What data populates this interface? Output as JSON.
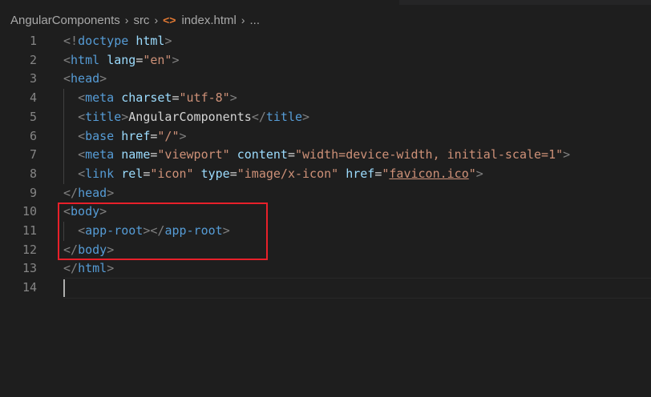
{
  "breadcrumb": {
    "project": "AngularComponents",
    "folder": "src",
    "file": "index.html",
    "more": "...",
    "file_icon_glyph": "<>"
  },
  "editor": {
    "lines": [
      {
        "number": "1",
        "tokens": [
          [
            "p",
            "<!"
          ],
          [
            "k",
            "doctype"
          ],
          [
            "x",
            " "
          ],
          [
            "a",
            "html"
          ],
          [
            "p",
            ">"
          ]
        ]
      },
      {
        "number": "2",
        "tokens": [
          [
            "p",
            "<"
          ],
          [
            "k",
            "html"
          ],
          [
            "x",
            " "
          ],
          [
            "a",
            "lang"
          ],
          [
            "x",
            "="
          ],
          [
            "s",
            "\"en\""
          ],
          [
            "p",
            ">"
          ]
        ]
      },
      {
        "number": "3",
        "tokens": [
          [
            "p",
            "<"
          ],
          [
            "k",
            "head"
          ],
          [
            "p",
            ">"
          ]
        ]
      },
      {
        "number": "4",
        "tokens": [
          [
            "x",
            "  "
          ],
          [
            "p",
            "<"
          ],
          [
            "k",
            "meta"
          ],
          [
            "x",
            " "
          ],
          [
            "a",
            "charset"
          ],
          [
            "x",
            "="
          ],
          [
            "s",
            "\"utf-8\""
          ],
          [
            "p",
            ">"
          ]
        ]
      },
      {
        "number": "5",
        "tokens": [
          [
            "x",
            "  "
          ],
          [
            "p",
            "<"
          ],
          [
            "k",
            "title"
          ],
          [
            "p",
            ">"
          ],
          [
            "x",
            "AngularComponents"
          ],
          [
            "p",
            "</"
          ],
          [
            "k",
            "title"
          ],
          [
            "p",
            ">"
          ]
        ]
      },
      {
        "number": "6",
        "tokens": [
          [
            "x",
            "  "
          ],
          [
            "p",
            "<"
          ],
          [
            "k",
            "base"
          ],
          [
            "x",
            " "
          ],
          [
            "a",
            "href"
          ],
          [
            "x",
            "="
          ],
          [
            "s",
            "\"/\""
          ],
          [
            "p",
            ">"
          ]
        ]
      },
      {
        "number": "7",
        "tokens": [
          [
            "x",
            "  "
          ],
          [
            "p",
            "<"
          ],
          [
            "k",
            "meta"
          ],
          [
            "x",
            " "
          ],
          [
            "a",
            "name"
          ],
          [
            "x",
            "="
          ],
          [
            "s",
            "\"viewport\""
          ],
          [
            "x",
            " "
          ],
          [
            "a",
            "content"
          ],
          [
            "x",
            "="
          ],
          [
            "s",
            "\"width=device-width, initial-scale=1\""
          ],
          [
            "p",
            ">"
          ]
        ]
      },
      {
        "number": "8",
        "tokens": [
          [
            "x",
            "  "
          ],
          [
            "p",
            "<"
          ],
          [
            "k",
            "link"
          ],
          [
            "x",
            " "
          ],
          [
            "a",
            "rel"
          ],
          [
            "x",
            "="
          ],
          [
            "s",
            "\"icon\""
          ],
          [
            "x",
            " "
          ],
          [
            "a",
            "type"
          ],
          [
            "x",
            "="
          ],
          [
            "s",
            "\"image/x-icon\""
          ],
          [
            "x",
            " "
          ],
          [
            "a",
            "href"
          ],
          [
            "x",
            "="
          ],
          [
            "s",
            "\""
          ],
          [
            "u",
            "favicon.ico"
          ],
          [
            "s",
            "\""
          ],
          [
            "p",
            ">"
          ]
        ]
      },
      {
        "number": "9",
        "tokens": [
          [
            "p",
            "</"
          ],
          [
            "k",
            "head"
          ],
          [
            "p",
            ">"
          ]
        ]
      },
      {
        "number": "10",
        "tokens": [
          [
            "p",
            "<"
          ],
          [
            "k",
            "body"
          ],
          [
            "p",
            ">"
          ]
        ]
      },
      {
        "number": "11",
        "tokens": [
          [
            "x",
            "  "
          ],
          [
            "p",
            "<"
          ],
          [
            "k",
            "app-root"
          ],
          [
            "p",
            "></"
          ],
          [
            "k",
            "app-root"
          ],
          [
            "p",
            ">"
          ]
        ]
      },
      {
        "number": "12",
        "tokens": [
          [
            "p",
            "</"
          ],
          [
            "k",
            "body"
          ],
          [
            "p",
            ">"
          ]
        ]
      },
      {
        "number": "13",
        "tokens": [
          [
            "p",
            "</"
          ],
          [
            "k",
            "html"
          ],
          [
            "p",
            ">"
          ]
        ]
      },
      {
        "number": "14",
        "tokens": []
      }
    ]
  },
  "colors": {
    "background": "#1e1e1e",
    "tag_bracket": "#808080",
    "tag_name": "#569cd6",
    "attribute": "#9cdcfe",
    "string": "#ce9178",
    "text": "#d4d4d4",
    "line_number": "#858585",
    "highlight_box": "#e8202a"
  }
}
